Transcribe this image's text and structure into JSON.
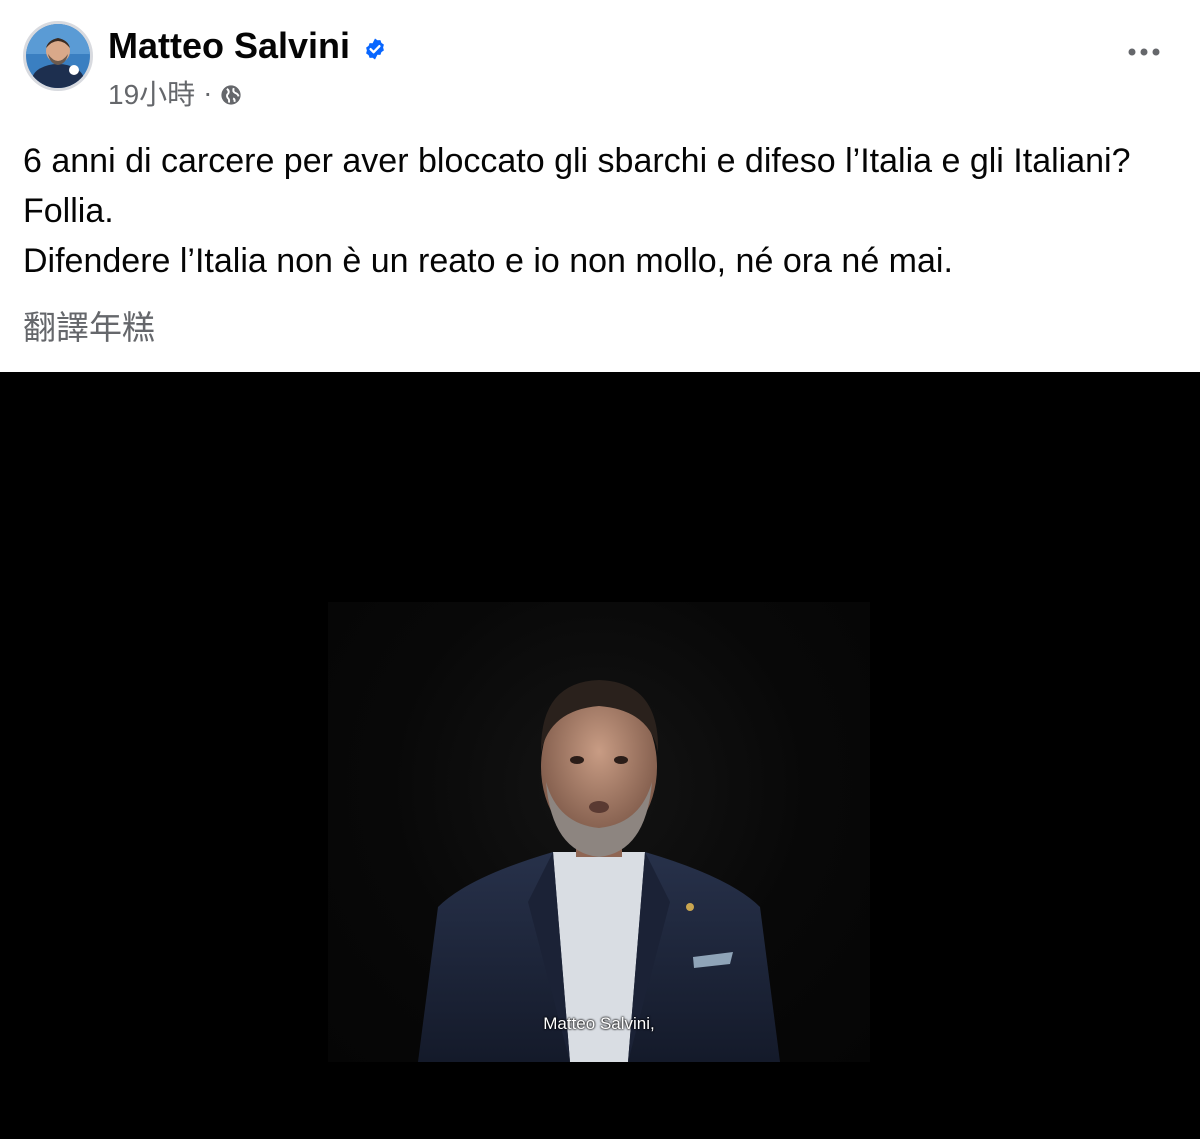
{
  "post": {
    "author": "Matteo Salvini",
    "verified_icon": "verified-badge-icon",
    "time": "19小時",
    "separator": "·",
    "audience_icon": "globe-icon",
    "more_icon": "more-options-icon",
    "text_lines": [
      "6 anni di carcere per aver bloccato gli sbarchi e difeso l’Italia e gli Italiani? Follia.",
      "Difendere l’Italia non è un reato e io non mollo, né ora né mai."
    ],
    "translate_label": "翻譯年糕"
  },
  "video": {
    "caption": "Matteo Salvini,"
  },
  "colors": {
    "verified_blue": "#0866ff",
    "secondary_text": "#65676b",
    "primary_text": "#050505",
    "video_bg": "#000000"
  }
}
